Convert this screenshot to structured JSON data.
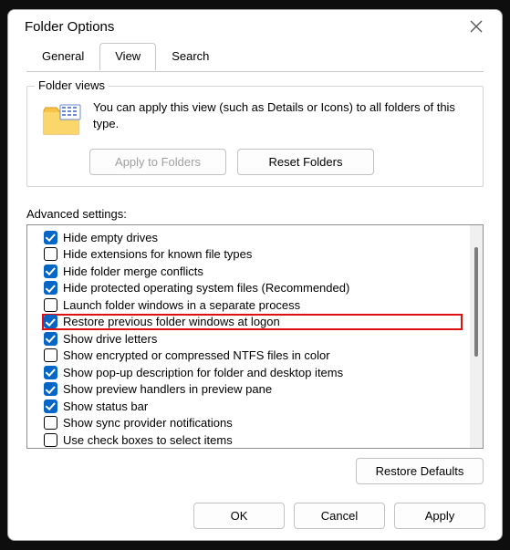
{
  "title": "Folder Options",
  "tabs": [
    {
      "label": "General",
      "active": false
    },
    {
      "label": "View",
      "active": true
    },
    {
      "label": "Search",
      "active": false
    }
  ],
  "folder_views": {
    "legend": "Folder views",
    "text": "You can apply this view (such as Details or Icons) to all folders of this type.",
    "apply_label": "Apply to Folders",
    "reset_label": "Reset Folders"
  },
  "advanced": {
    "label": "Advanced settings:",
    "items": [
      {
        "label": "Hide empty drives",
        "checked": true,
        "highlight": false
      },
      {
        "label": "Hide extensions for known file types",
        "checked": false,
        "highlight": false
      },
      {
        "label": "Hide folder merge conflicts",
        "checked": true,
        "highlight": false
      },
      {
        "label": "Hide protected operating system files (Recommended)",
        "checked": true,
        "highlight": false
      },
      {
        "label": "Launch folder windows in a separate process",
        "checked": false,
        "highlight": false
      },
      {
        "label": "Restore previous folder windows at logon",
        "checked": true,
        "highlight": true
      },
      {
        "label": "Show drive letters",
        "checked": true,
        "highlight": false
      },
      {
        "label": "Show encrypted or compressed NTFS files in color",
        "checked": false,
        "highlight": false
      },
      {
        "label": "Show pop-up description for folder and desktop items",
        "checked": true,
        "highlight": false
      },
      {
        "label": "Show preview handlers in preview pane",
        "checked": true,
        "highlight": false
      },
      {
        "label": "Show status bar",
        "checked": true,
        "highlight": false
      },
      {
        "label": "Show sync provider notifications",
        "checked": false,
        "highlight": false
      },
      {
        "label": "Use check boxes to select items",
        "checked": false,
        "highlight": false
      }
    ]
  },
  "restore_defaults_label": "Restore Defaults",
  "buttons": {
    "ok": "OK",
    "cancel": "Cancel",
    "apply": "Apply"
  }
}
